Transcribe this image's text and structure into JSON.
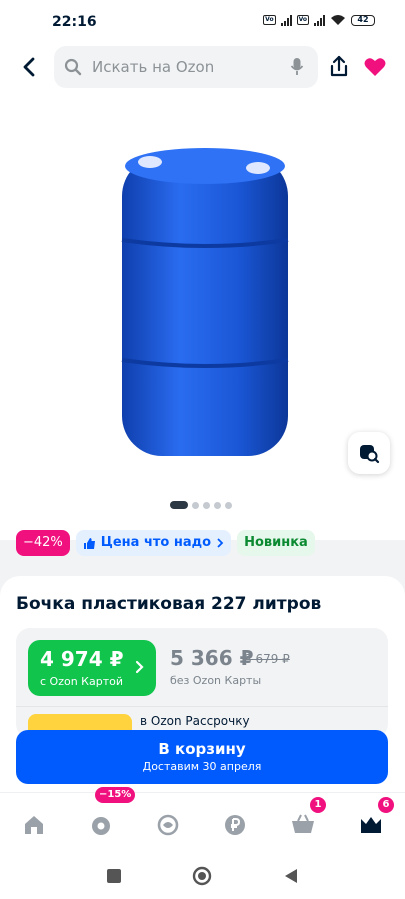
{
  "status_bar": {
    "time": "22:16",
    "battery": "42"
  },
  "search": {
    "placeholder": "Искать на Ozon"
  },
  "badges": {
    "discount": "−42%",
    "price_label": "Цена что надо",
    "new_label": "Новинка"
  },
  "product": {
    "title": "Бочка пластиковая 227 литров",
    "image_icon": "blue-plastic-barrel",
    "image_pager": {
      "total": 5,
      "current": 1
    }
  },
  "pricing": {
    "ozon_card_price": "4 974 ₽",
    "ozon_card_label": "с Ozon Картой",
    "regular_price": "5 366 ₽",
    "old_price": "8 679 ₽",
    "regular_label": "без Ozon Карты",
    "installment_text": "в Ozon Рассрочку"
  },
  "cart_button": {
    "label": "В корзину",
    "sublabel": "Доставим 30 апреля"
  },
  "bottom_nav": {
    "items": [
      {
        "icon": "home-icon",
        "badge": ""
      },
      {
        "icon": "catalog-icon",
        "badge": "−15%"
      },
      {
        "icon": "fresh-icon",
        "badge": ""
      },
      {
        "icon": "ruble-icon",
        "badge": ""
      },
      {
        "icon": "cart-icon",
        "badge": "1"
      },
      {
        "icon": "profile-icon",
        "badge": "6"
      }
    ]
  },
  "colors": {
    "accent": "#005bff",
    "ozon_card_green": "#10c44c",
    "discount_pink": "#f1117e",
    "favorite_red": "#f1117e",
    "barrel_blue": "#1a57d6"
  }
}
